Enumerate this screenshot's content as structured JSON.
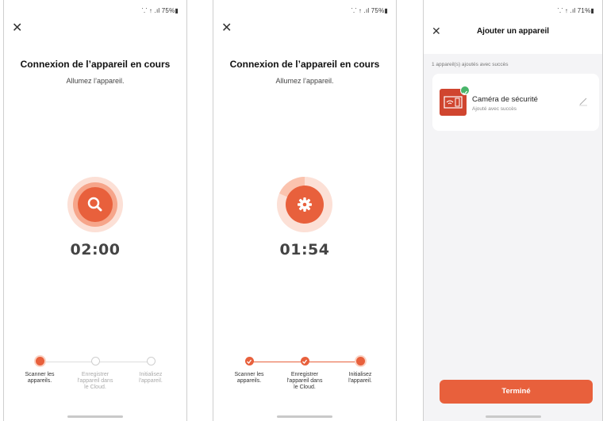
{
  "accent_color": "#e8603c",
  "screens": [
    {
      "status_bar": "⸪ ↑ .ıl 75%▮",
      "title": "Connexion de l’appareil en cours",
      "subtitle": "Allumez l’appareil.",
      "center_icon": "search-icon",
      "timer": "02:00",
      "progress_fraction": 0.0,
      "steps": [
        {
          "label": "Scanner les appareils.",
          "state": "active"
        },
        {
          "label": "Enregistrer l'appareil dans le Cloud.",
          "state": "pending"
        },
        {
          "label": "Initialisez l'appareil.",
          "state": "pending"
        }
      ]
    },
    {
      "status_bar": "⸪ ↑ .ıl 75%▮",
      "title": "Connexion de l’appareil en cours",
      "subtitle": "Allumez l’appareil.",
      "center_icon": "gear-icon",
      "timer": "01:54",
      "progress_fraction": 0.18,
      "steps": [
        {
          "label": "Scanner les appareils.",
          "state": "done"
        },
        {
          "label": "Enregistrer l'appareil dans le Cloud.",
          "state": "done"
        },
        {
          "label": "Initialisez l'appareil.",
          "state": "active"
        }
      ]
    }
  ],
  "result_screen": {
    "status_bar": "⸪ ↑ .ıl 71%▮",
    "title": "Ajouter un appareil",
    "summary": "1 appareil(s) ajoutés avec succès",
    "device_name": "Caméra de sécurité",
    "device_status": "Ajouté avec succès",
    "done_button": "Terminé"
  }
}
